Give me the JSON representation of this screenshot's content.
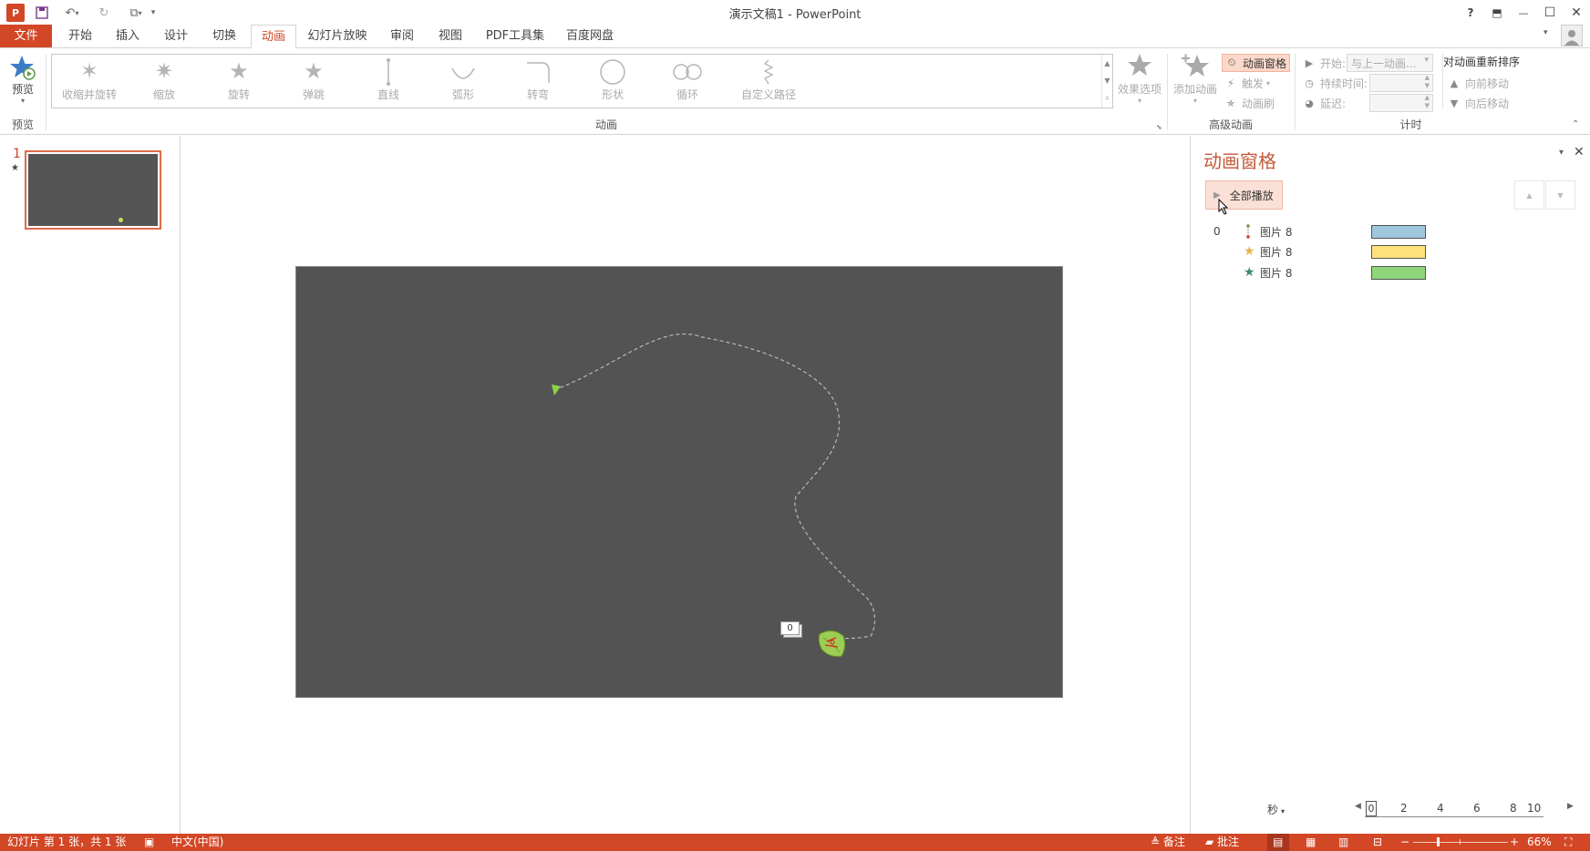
{
  "window": {
    "title": "演示文稿1 - PowerPoint",
    "app_logo": "P",
    "controls": {
      "help": "?",
      "restore_ribbon": "⬒",
      "minimize": "—",
      "maximize": "☐",
      "close": "✕"
    }
  },
  "tabs": [
    "文件",
    "开始",
    "插入",
    "设计",
    "切换",
    "动画",
    "幻灯片放映",
    "审阅",
    "视图",
    "PDF工具集",
    "百度网盘"
  ],
  "active_tab": "动画",
  "ribbon": {
    "preview_group": {
      "button": "预览",
      "label": "预览"
    },
    "animation_group": {
      "label": "动画",
      "gallery": [
        "收缩并旋转",
        "缩放",
        "旋转",
        "弹跳",
        "直线",
        "弧形",
        "转弯",
        "形状",
        "循环",
        "自定义路径"
      ],
      "effect_options": "效果选项"
    },
    "advanced_group": {
      "label": "高级动画",
      "add_animation": "添加动画",
      "animation_pane": "动画窗格",
      "trigger": "触发",
      "animation_painter": "动画刷"
    },
    "timing_group": {
      "label": "计时",
      "start_label": "开始:",
      "start_value": "与上一动画...",
      "duration_label": "持续时间:",
      "delay_label": "延迟:",
      "reorder_title": "对动画重新排序",
      "move_earlier": "向前移动",
      "move_later": "向后移动"
    }
  },
  "thumbnails": [
    {
      "number": "1",
      "marker": "★"
    }
  ],
  "slide": {
    "tag_number": "0"
  },
  "animation_pane": {
    "title": "动画窗格",
    "play_all": "全部播放",
    "rows": [
      {
        "index": "0",
        "icon": "motion-path-icon",
        "name": "图片 8",
        "color": "#9ec6dc"
      },
      {
        "index": "",
        "icon": "star-gold-icon",
        "name": "图片 8",
        "color": "#ffe17a"
      },
      {
        "index": "",
        "icon": "star-green-icon",
        "name": "图片 8",
        "color": "#8fd67a"
      }
    ],
    "timeline_unit": "秒",
    "ticks": [
      "0",
      "2",
      "4",
      "6",
      "8",
      "10"
    ]
  },
  "statusbar": {
    "slide_info": "幻灯片 第 1 张，共 1 张",
    "language": "中文(中国)",
    "notes": "备注",
    "comments": "批注",
    "zoom": "66%"
  }
}
